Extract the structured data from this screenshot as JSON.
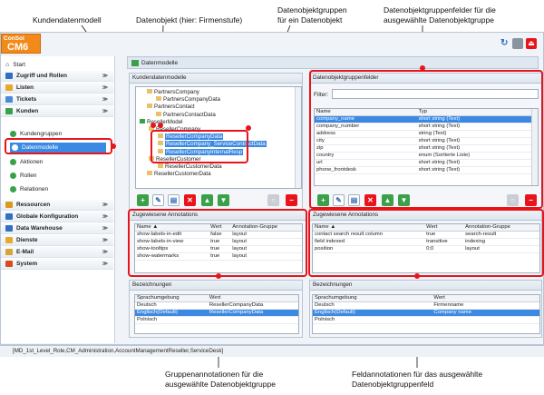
{
  "callouts": {
    "c1": "Kundendatenmodell",
    "c2": "Datenobjekt (hier: Firmenstufe)",
    "c3a": "Datenobjektgruppen",
    "c3b": "für ein Datenobjekt",
    "c4a": "Datenobjektgruppenfelder für die",
    "c4b": "ausgewählte Datenobjektgruppe",
    "c5a": "Gruppenannotationen für die",
    "c5b": "ausgewählte Datenobjektgruppe",
    "c6a": "Feldannotationen für das ausgewählte",
    "c6b": "Datenobjektgruppenfeld"
  },
  "app": {
    "logo_top": "ConSol",
    "logo_bottom": "CM6"
  },
  "sidebar": {
    "start": "Start",
    "items": [
      {
        "label": "Zugriff und Rollen",
        "icon": "chevrons-icon",
        "color": "#2f6fc4"
      },
      {
        "label": "Listen",
        "icon": "list-icon",
        "color": "#e7a92b"
      },
      {
        "label": "Tickets",
        "icon": "ticket-icon",
        "color": "#4a8ad6"
      },
      {
        "label": "Kunden",
        "icon": "person-icon",
        "color": "#3aa14a"
      }
    ],
    "sub": [
      "Kundengruppen",
      "Datenmodelle",
      "Aktionen",
      "Rollen",
      "Relationen"
    ],
    "items2": [
      {
        "label": "Ressourcen",
        "icon": "resource-icon",
        "color": "#d99a1d"
      },
      {
        "label": "Globale Konfiguration",
        "icon": "globe-icon",
        "color": "#2f6fc4"
      },
      {
        "label": "Data Warehouse",
        "icon": "database-icon",
        "color": "#2f6fc4"
      },
      {
        "label": "Dienste",
        "icon": "services-icon",
        "color": "#e7a92b"
      },
      {
        "label": "E-Mail",
        "icon": "mail-icon",
        "color": "#d9a437"
      },
      {
        "label": "System",
        "icon": "system-icon",
        "color": "#d94d1d"
      }
    ]
  },
  "main": {
    "title": "Datenmodelle"
  },
  "left": {
    "header": "Kundendatenmodelle",
    "tree": [
      "PartnersCompany",
      "PartnersCompanyData",
      "PartnersContact",
      "PartnersContactData",
      "ResellerModel",
      "ResellerCompany",
      "ResellerCompanyData",
      "ResellerCompany_ServiceContractData",
      "ResellerCompanyInternalResp",
      "ResellerCustomer",
      "ResellerCustomerData",
      "ResellerCustomerData"
    ]
  },
  "right": {
    "header": "Datenobjektgruppenfelder",
    "filter": "Filter:",
    "cols": [
      "Name",
      "Typ"
    ],
    "rows": [
      [
        "company_name",
        "short string (Text)"
      ],
      [
        "company_number",
        "short string (Text)"
      ],
      [
        "address",
        "string (Text)"
      ],
      [
        "city",
        "short string (Text)"
      ],
      [
        "zip",
        "short string (Text)"
      ],
      [
        "country",
        "enum (Sortierte Liste)"
      ],
      [
        "url",
        "short string (Text)"
      ],
      [
        "phone_frontdesk",
        "short string (Text)"
      ]
    ]
  },
  "ann_left": {
    "header": "Zugewiesene Annotations",
    "cols": [
      "Name ▲",
      "Wert",
      "Annotation-Gruppe"
    ],
    "rows": [
      [
        "show-labels-in-edit",
        "false",
        "layout"
      ],
      [
        "show-labels-in-view",
        "true",
        "layout"
      ],
      [
        "show-tooltips",
        "true",
        "layout"
      ],
      [
        "show-watermarks",
        "true",
        "layout"
      ]
    ]
  },
  "ann_right": {
    "header": "Zugewiesene Annotations",
    "cols": [
      "Name ▲",
      "Wert",
      "Annotation-Gruppe"
    ],
    "rows": [
      [
        "contact search result column",
        "true",
        "search-result"
      ],
      [
        "field indexed",
        "transitive",
        "indexing"
      ],
      [
        "position",
        "0;0",
        "layout"
      ]
    ]
  },
  "bez_left": {
    "header": "Bezeichnungen",
    "cols": [
      "Sprachumgebung",
      "Wert"
    ],
    "rows": [
      [
        "Deutsch",
        "ResellerCompanyData"
      ],
      [
        "Englisch(Default)",
        "ResellerCompanyData"
      ],
      [
        "Polnisch",
        ""
      ]
    ]
  },
  "bez_right": {
    "header": "Bezeichnungen",
    "cols": [
      "Sprachumgebung",
      "Wert"
    ],
    "rows": [
      [
        "Deutsch",
        "Firmenname"
      ],
      [
        "Englisch(Default)",
        "Company name"
      ],
      [
        "Polnisch",
        ""
      ]
    ]
  },
  "status": "[MD_1st_Level_Role,CM_Administration,AccountManagementReseller,ServiceDesk]"
}
